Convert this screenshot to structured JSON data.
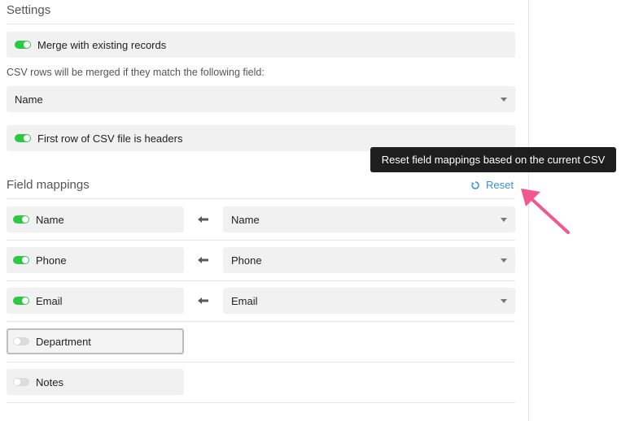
{
  "settings": {
    "title": "Settings",
    "merge_toggle": {
      "label": "Merge with existing records",
      "on": true
    },
    "merge_hint": "CSV rows will be merged if they match the following field:",
    "merge_field": {
      "selected": "Name"
    },
    "headers_toggle": {
      "label": "First row of CSV file is headers",
      "on": true
    }
  },
  "field_mappings": {
    "title": "Field mappings",
    "reset_label": "Reset",
    "reset_tooltip": "Reset field mappings based on the current CSV",
    "rows": [
      {
        "field": "Name",
        "enabled": true,
        "csv_column": "Name"
      },
      {
        "field": "Phone",
        "enabled": true,
        "csv_column": "Phone"
      },
      {
        "field": "Email",
        "enabled": true,
        "csv_column": "Email"
      },
      {
        "field": "Department",
        "enabled": false,
        "csv_column": null
      },
      {
        "field": "Notes",
        "enabled": false,
        "csv_column": null
      }
    ]
  },
  "colors": {
    "toggle_on": "#2ec944",
    "toggle_off": "#dcdcdc",
    "link": "#3b8fe0",
    "tooltip_bg": "#1e1e1e",
    "annotation_arrow": "#f2588f"
  },
  "icons": {
    "reset": "refresh-icon",
    "mapping_arrow": "arrow-left-icon",
    "dropdown": "caret-down-icon"
  }
}
